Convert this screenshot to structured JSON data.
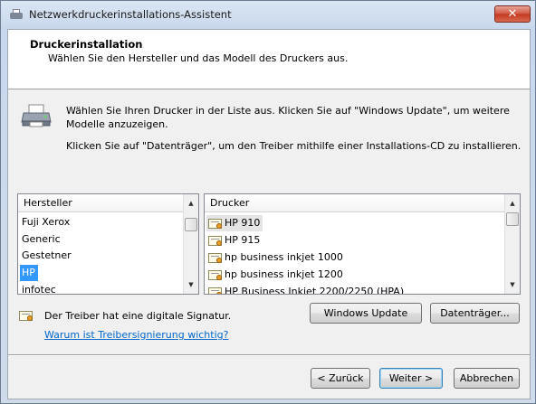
{
  "window": {
    "title": "Netzwerkdruckerinstallations-Assistent",
    "close_label": "✕"
  },
  "header": {
    "title": "Druckerinstallation",
    "subtitle": "Wählen Sie den Hersteller und das Modell des Druckers aus."
  },
  "instructions": {
    "line1": "Wählen Sie Ihren Drucker in der Liste aus. Klicken Sie auf \"Windows Update\", um weitere Modelle anzuzeigen.",
    "line2": "Klicken Sie auf \"Datenträger\", um den Treiber mithilfe einer Installations-CD zu installieren."
  },
  "manufacturer_list": {
    "header": "Hersteller",
    "items": [
      "Fuji Xerox",
      "Generic",
      "Gestetner",
      "HP",
      "infotec"
    ],
    "selected": "HP"
  },
  "printer_list": {
    "header": "Drucker",
    "items": [
      "HP 910",
      "HP 915",
      "hp business inkjet 1000",
      "hp business inkjet 1200",
      "HP Business Inkjet 2200/2250 (HPA)"
    ],
    "selected": "HP 910"
  },
  "signature": {
    "text": "Der Treiber hat eine digitale Signatur.",
    "link": "Warum ist Treibersignierung wichtig?"
  },
  "buttons": {
    "windows_update": "Windows Update",
    "have_disk": "Datenträger...",
    "back": "< Zurück",
    "next": "Weiter >",
    "cancel": "Abbrechen"
  },
  "icons": {
    "title": "printer-icon",
    "main": "printer-icon",
    "item": "certificate-icon"
  },
  "colors": {
    "selection": "#3399ff",
    "link": "#0066cc"
  }
}
